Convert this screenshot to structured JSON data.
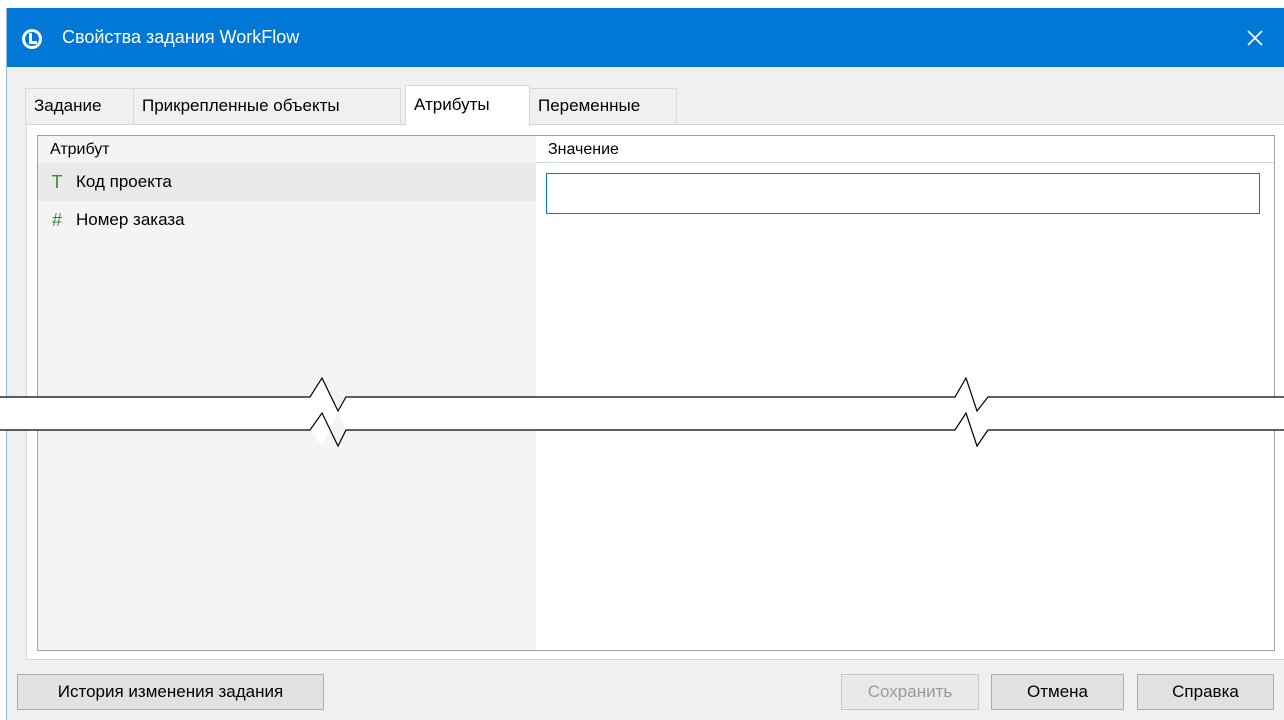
{
  "window": {
    "title": "Свойства задания WorkFlow",
    "app_icon": "workflow-app-icon",
    "close_icon": "close-icon"
  },
  "tabs": [
    {
      "label": "Задание",
      "active": false
    },
    {
      "label": "Прикрепленные объекты",
      "active": false
    },
    {
      "label": "Атрибуты",
      "active": true
    },
    {
      "label": "Переменные",
      "active": false
    }
  ],
  "grid": {
    "columns": [
      "Атрибут",
      "Значение"
    ],
    "rows": [
      {
        "icon": "text-type-icon",
        "icon_glyph": "T",
        "label": "Код проекта",
        "value": "",
        "selected": true
      },
      {
        "icon": "number-type-icon",
        "icon_glyph": "#",
        "label": "Номер заказа",
        "value": "",
        "selected": false
      }
    ]
  },
  "buttons": {
    "history": "История изменения задания",
    "save": "Сохранить",
    "cancel": "Отмена",
    "help": "Справка"
  },
  "colors": {
    "titlebar": "#0078d7",
    "icon_green": "#2e8b3a",
    "focus_border": "#0078d7"
  }
}
